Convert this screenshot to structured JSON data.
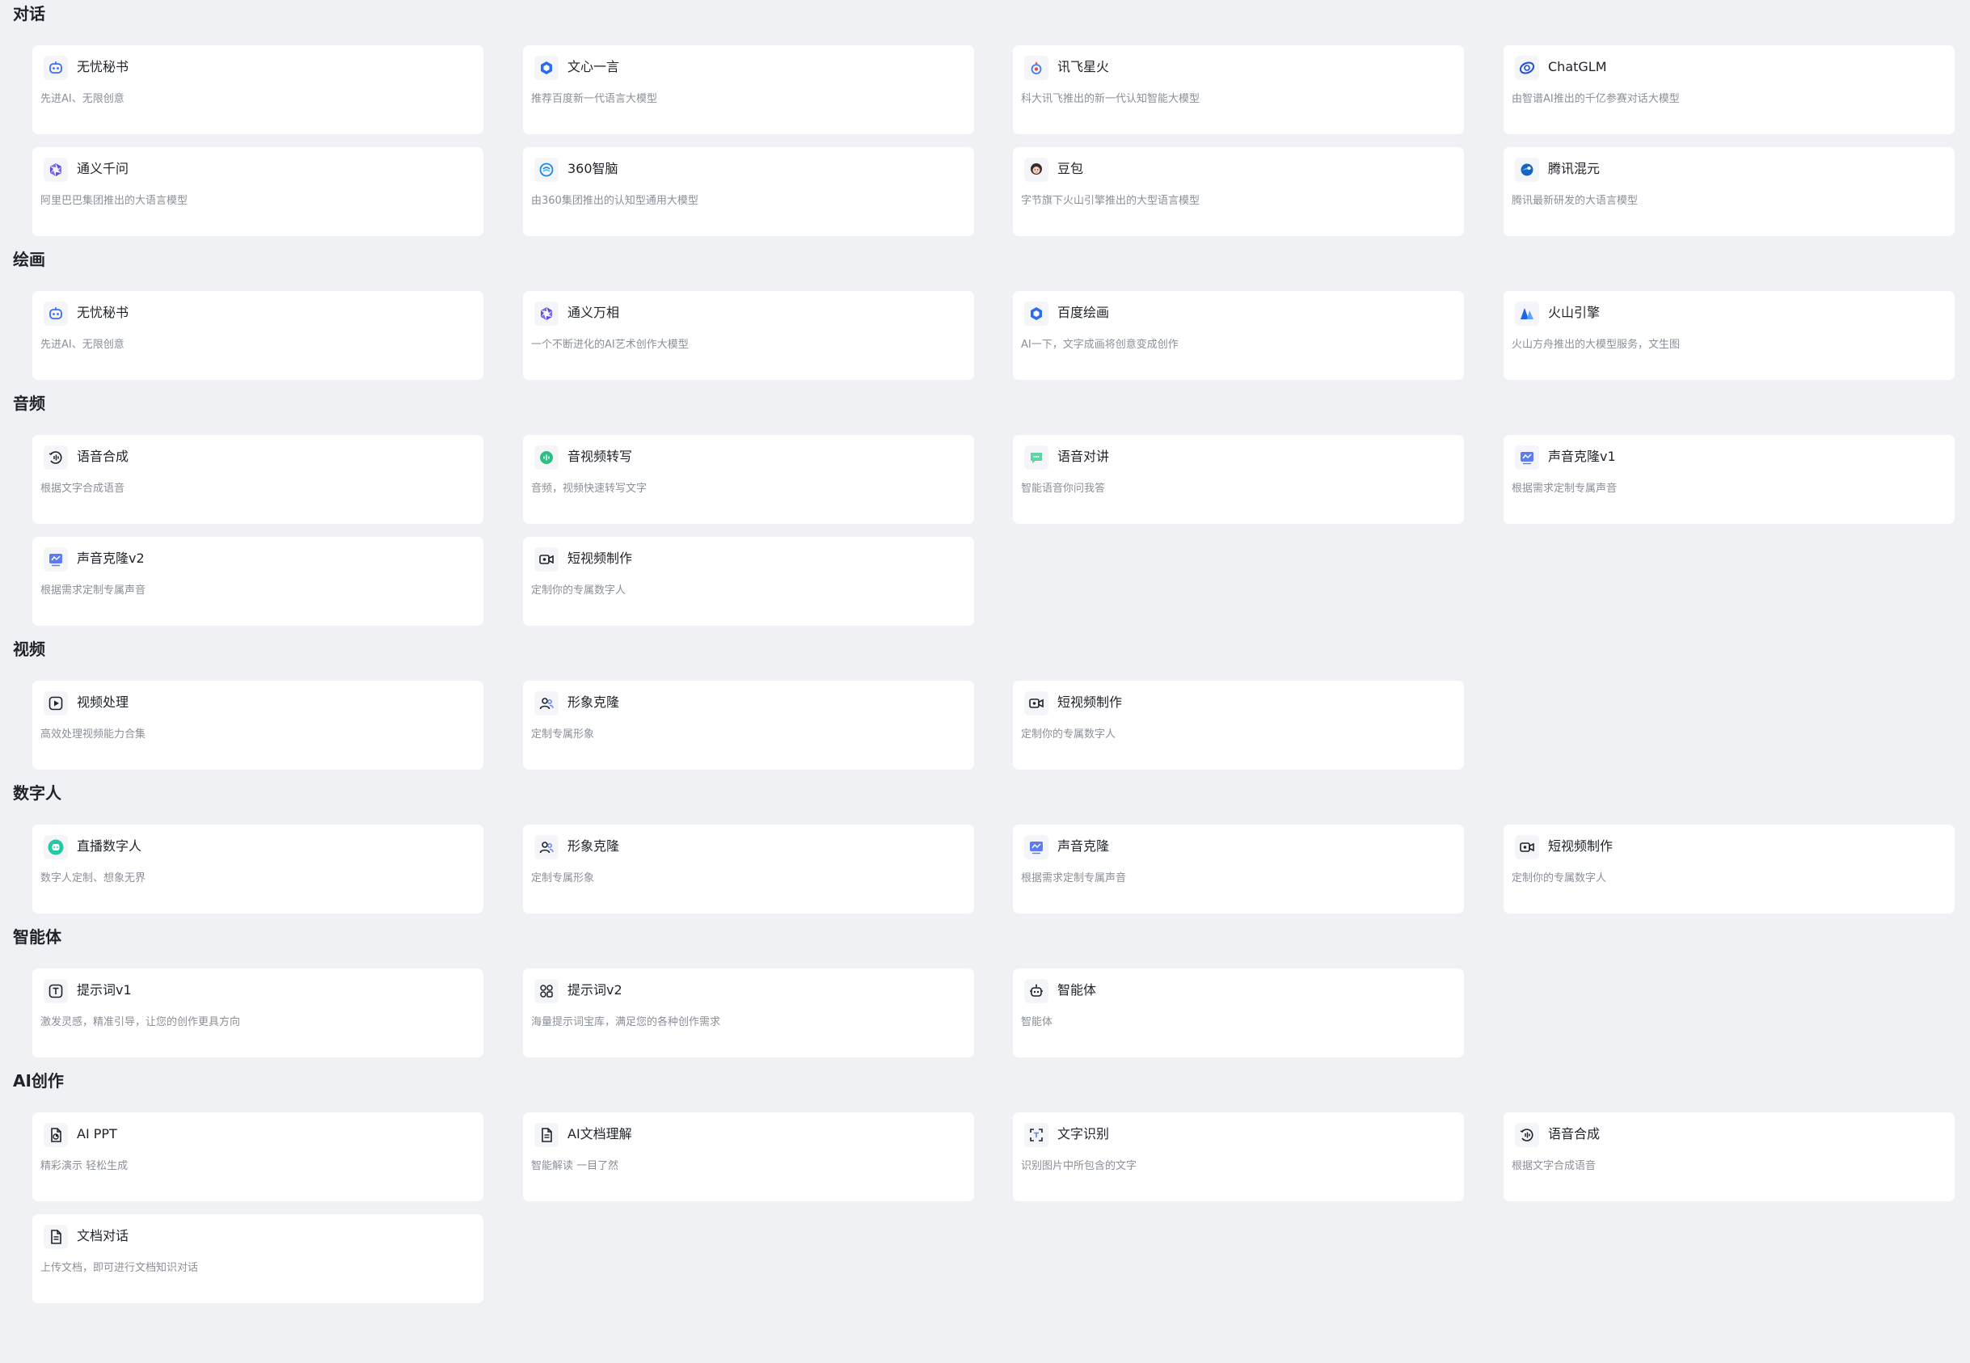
{
  "sections": [
    {
      "title": "对话",
      "items": [
        {
          "name": "无忧秘书",
          "desc": "先进AI、无限创意",
          "icon": "robot-face-icon",
          "color": "#3b6cf6"
        },
        {
          "name": "文心一言",
          "desc": "推荐百度新一代语言大模型",
          "icon": "hexagon-icon",
          "color": "#2d6bf2"
        },
        {
          "name": "讯飞星火",
          "desc": "科大讯飞推出的新一代认知智能大模型",
          "icon": "spark-icon",
          "color": "#3b7cf5"
        },
        {
          "name": "ChatGLM",
          "desc": "由智谱AI推出的千亿参赛对话大模型",
          "icon": "orbit-icon",
          "color": "#1d4ed8"
        },
        {
          "name": "通义千问",
          "desc": "阿里巴巴集团推出的大语言模型",
          "icon": "tongyi-icon",
          "color": "#5b4be8"
        },
        {
          "name": "360智脑",
          "desc": "由360集团推出的认知型通用大模型",
          "icon": "brain-icon",
          "color": "#1e88e5"
        },
        {
          "name": "豆包",
          "desc": "字节旗下火山引擎推出的大型语言模型",
          "icon": "avatar-girl-icon",
          "color": "#e57373"
        },
        {
          "name": "腾讯混元",
          "desc": "腾讯最新研发的大语言模型",
          "icon": "hunyuan-icon",
          "color": "#1565c0"
        }
      ]
    },
    {
      "title": "绘画",
      "items": [
        {
          "name": "无忧秘书",
          "desc": "先进AI、无限创意",
          "icon": "robot-face-icon",
          "color": "#3b6cf6"
        },
        {
          "name": "通义万相",
          "desc": "一个不断进化的AI艺术创作大模型",
          "icon": "tongyi-icon",
          "color": "#5b4be8"
        },
        {
          "name": "百度绘画",
          "desc": "AI一下，文字成画将创意变成创作",
          "icon": "hexagon-icon",
          "color": "#2d6bf2"
        },
        {
          "name": "火山引擎",
          "desc": "火山方舟推出的大模型服务，文生图",
          "icon": "mountain-icon",
          "color": "#1e63e9"
        }
      ]
    },
    {
      "title": "音频",
      "items": [
        {
          "name": "语音合成",
          "desc": "根据文字合成语音",
          "icon": "voice-synth-icon",
          "color": "#1f2329"
        },
        {
          "name": "音视频转写",
          "desc": "音频，视频快速转写文字",
          "icon": "transcribe-icon",
          "color": "#2ebd85"
        },
        {
          "name": "语音对讲",
          "desc": "智能语音你问我答",
          "icon": "chat-bubble-icon",
          "color": "#5fd3a8"
        },
        {
          "name": "声音克隆v1",
          "desc": "根据需求定制专属声音",
          "icon": "voice-clone-icon",
          "color": "#5b7cf5"
        },
        {
          "name": "声音克隆v2",
          "desc": "根据需求定制专属声音",
          "icon": "voice-clone-icon",
          "color": "#5b7cf5"
        },
        {
          "name": "短视频制作",
          "desc": "定制你的专属数字人",
          "icon": "video-camera-icon",
          "color": "#1f2329"
        }
      ]
    },
    {
      "title": "视频",
      "items": [
        {
          "name": "视频处理",
          "desc": "高效处理视频能力合集",
          "icon": "play-square-icon",
          "color": "#1f2329"
        },
        {
          "name": "形象克隆",
          "desc": "定制专属形象",
          "icon": "users-icon",
          "color": "#1f2329"
        },
        {
          "name": "短视频制作",
          "desc": "定制你的专属数字人",
          "icon": "video-camera-icon",
          "color": "#1f2329"
        }
      ]
    },
    {
      "title": "数字人",
      "items": [
        {
          "name": "直播数字人",
          "desc": "数字人定制、想象无界",
          "icon": "live-avatar-icon",
          "color": "#21c9a6"
        },
        {
          "name": "形象克隆",
          "desc": "定制专属形象",
          "icon": "users-icon",
          "color": "#1f2329"
        },
        {
          "name": "声音克隆",
          "desc": "根据需求定制专属声音",
          "icon": "voice-clone-icon",
          "color": "#5b7cf5"
        },
        {
          "name": "短视频制作",
          "desc": "定制你的专属数字人",
          "icon": "video-camera-icon",
          "color": "#1f2329"
        }
      ]
    },
    {
      "title": "智能体",
      "items": [
        {
          "name": "提示词v1",
          "desc": "激发灵感，精准引导，让您的创作更具方向",
          "icon": "text-box-icon",
          "color": "#1f2329"
        },
        {
          "name": "提示词v2",
          "desc": "海量提示词宝库，满足您的各种创作需求",
          "icon": "grid-apps-icon",
          "color": "#1f2329"
        },
        {
          "name": "智能体",
          "desc": "智能体",
          "icon": "robot-icon",
          "color": "#1f2329"
        }
      ]
    },
    {
      "title": "AI创作",
      "items": [
        {
          "name": "AI PPT",
          "desc": "精彩演示 轻松生成",
          "icon": "ppt-file-icon",
          "color": "#1f2329"
        },
        {
          "name": "AI文档理解",
          "desc": "智能解读 一目了然",
          "icon": "doc-file-icon",
          "color": "#1f2329"
        },
        {
          "name": "文字识别",
          "desc": "识别图片中所包含的文字",
          "icon": "scan-text-icon",
          "color": "#1f2329"
        },
        {
          "name": "语音合成",
          "desc": "根据文字合成语音",
          "icon": "voice-synth-icon",
          "color": "#1f2329"
        },
        {
          "name": "文档对话",
          "desc": "上传文档，即可进行文档知识对话",
          "icon": "doc-file-icon",
          "color": "#1f2329"
        }
      ]
    }
  ]
}
